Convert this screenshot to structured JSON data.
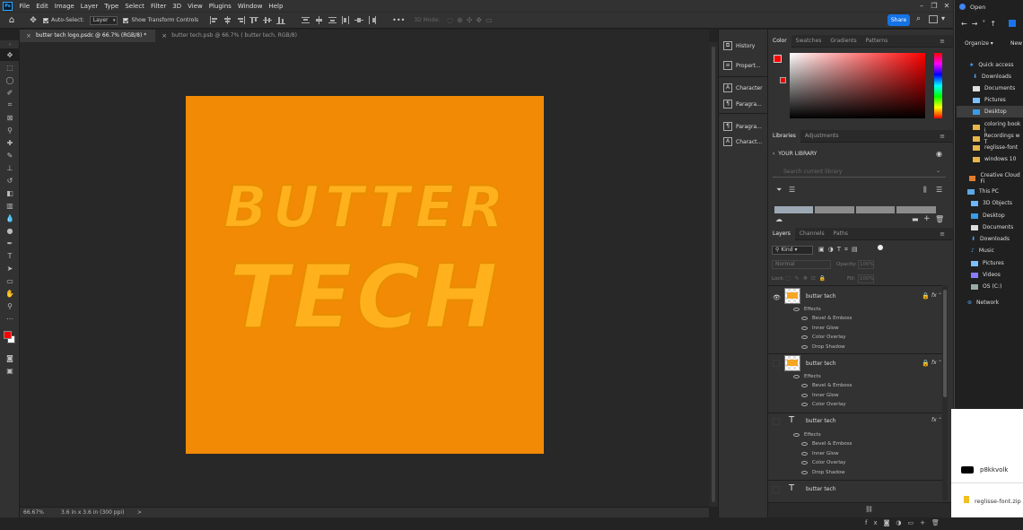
{
  "menu": [
    "File",
    "Edit",
    "Image",
    "Layer",
    "Type",
    "Select",
    "Filter",
    "3D",
    "View",
    "Plugins",
    "Window",
    "Help"
  ],
  "options": {
    "auto_select": "Auto-Select:",
    "auto_select_value": "Layer",
    "show_transform": "Show Transform Controls",
    "mode_3d": "3D Mode:",
    "more": "•••",
    "share": "Share"
  },
  "tabs": [
    {
      "label": "butter tech logo.psdc @ 66.7% (RGB/8) *"
    },
    {
      "label": "butter  tech.psb @ 66.7% ( butter  tech, RGB/8)"
    }
  ],
  "artboard": {
    "line1": "BUTTER",
    "line2": "TECH",
    "bg": "#f28a05"
  },
  "status": {
    "zoom": "66.67%",
    "doc": "3.6 in x 3.6 in (300 ppi)",
    "arrow": ">"
  },
  "collapsed_panels": [
    "History",
    "Propert...",
    "Character",
    "Paragra...",
    "Paragra...",
    "Charact..."
  ],
  "color_panel": {
    "tabs": [
      "Color",
      "Swatches",
      "Gradients",
      "Patterns"
    ],
    "fg": "#ff0000"
  },
  "libraries": {
    "tabs": [
      "Libraries",
      "Adjustments"
    ],
    "title": "YOUR LIBRARY",
    "search_placeholder": "Search current library"
  },
  "layers_panel": {
    "tabs": [
      "Layers",
      "Channels",
      "Paths"
    ],
    "kind": "Kind",
    "blend": "Normal",
    "opacity_label": "Opacity:",
    "opacity": "100%",
    "lock_label": "Lock:",
    "fill_label": "Fill:",
    "fill": "100%",
    "layers": [
      {
        "name": "butter  tech",
        "effects_label": "Effects",
        "effects": [
          "Bevel & Emboss",
          "Inner Glow",
          "Color Overlay",
          "Drop Shadow"
        ]
      },
      {
        "name": "butter  tech",
        "effects_label": "Effects",
        "effects": [
          "Bevel & Emboss",
          "Inner Glow",
          "Color Overlay"
        ]
      },
      {
        "name": "butter  tech",
        "effects_label": "Effects",
        "effects": [
          "Bevel & Emboss",
          "Inner Glow",
          "Color Overlay",
          "Drop Shadow"
        ]
      },
      {
        "name": "butter  tech"
      }
    ],
    "fx": "fx"
  },
  "explorer": {
    "title": "Open",
    "organize": "Organize ▾",
    "new": "New",
    "items": [
      "Quick access",
      "Downloads",
      "Documents",
      "Pictures",
      "Desktop",
      "coloring book i",
      "Recordings w T",
      "reglisse-font",
      "windows 10",
      "Creative Cloud Fi",
      "This PC",
      "3D Objects",
      "Desktop",
      "Documents",
      "Downloads",
      "Music",
      "Pictures",
      "Videos",
      "OS (C:)",
      "Network"
    ]
  },
  "chrome": {
    "user": "p8kkvolk",
    "download": "reglisse-font.zip"
  }
}
